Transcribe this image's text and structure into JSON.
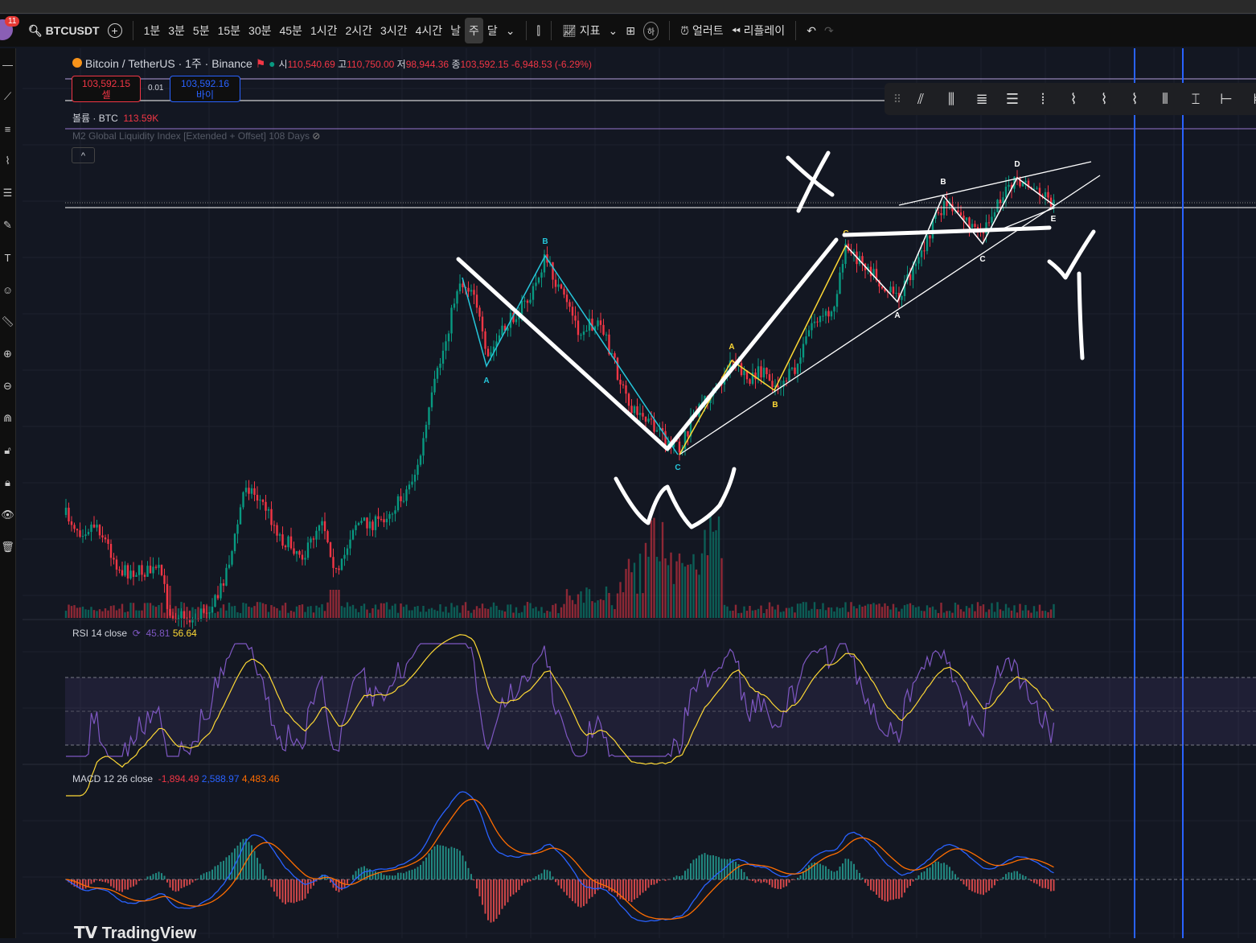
{
  "toolbar": {
    "notification_count": "11",
    "symbol": "BTCUSDT",
    "intervals": [
      "1분",
      "3분",
      "5분",
      "15분",
      "30분",
      "45분",
      "1시간",
      "2시간",
      "3시간",
      "4시간",
      "날",
      "주",
      "달"
    ],
    "active_interval": "주",
    "indicators": "지표",
    "hotkey": "하",
    "alert": "얼러트",
    "replay": "리플레이"
  },
  "legend": {
    "title": "Bitcoin / TetherUS · 1주 · Binance",
    "open_label": "시",
    "open": "110,540.69",
    "high_label": "고",
    "high": "110,750.00",
    "low_label": "저",
    "low": "98,944.36",
    "close_label": "종",
    "close": "103,592.15",
    "change": "-6,948.53 (-6.29%)"
  },
  "trade": {
    "sell_price": "103,592.15",
    "sell_label": "셀",
    "spread": "0.01",
    "buy_price": "103,592.16",
    "buy_label": "바이"
  },
  "volume": {
    "label": "볼륨 · BTC",
    "value": "113.59K"
  },
  "m2": {
    "label": "M2 Global Liquidity Index [Extended + Offset] 108 Days"
  },
  "waves": {
    "cyan": [
      "A",
      "B",
      "C"
    ],
    "yellow": [
      "A",
      "B",
      "C"
    ],
    "white": [
      "A",
      "B",
      "C",
      "D",
      "E"
    ]
  },
  "rsi": {
    "label": "RSI 14 close",
    "rsi": "45.81",
    "ma": "56.64"
  },
  "macd": {
    "label": "MACD 12 26 close",
    "hist": "-1,894.49",
    "macd": "2,588.97",
    "signal": "4,483.46"
  },
  "brand": "TradingView",
  "colors": {
    "up": "#089981",
    "down": "#f23645",
    "cyan": "#26c6da",
    "yellow": "#fdd835",
    "rsi": "#7e57c2",
    "macd": "#2962ff",
    "signal": "#ff6d00"
  }
}
